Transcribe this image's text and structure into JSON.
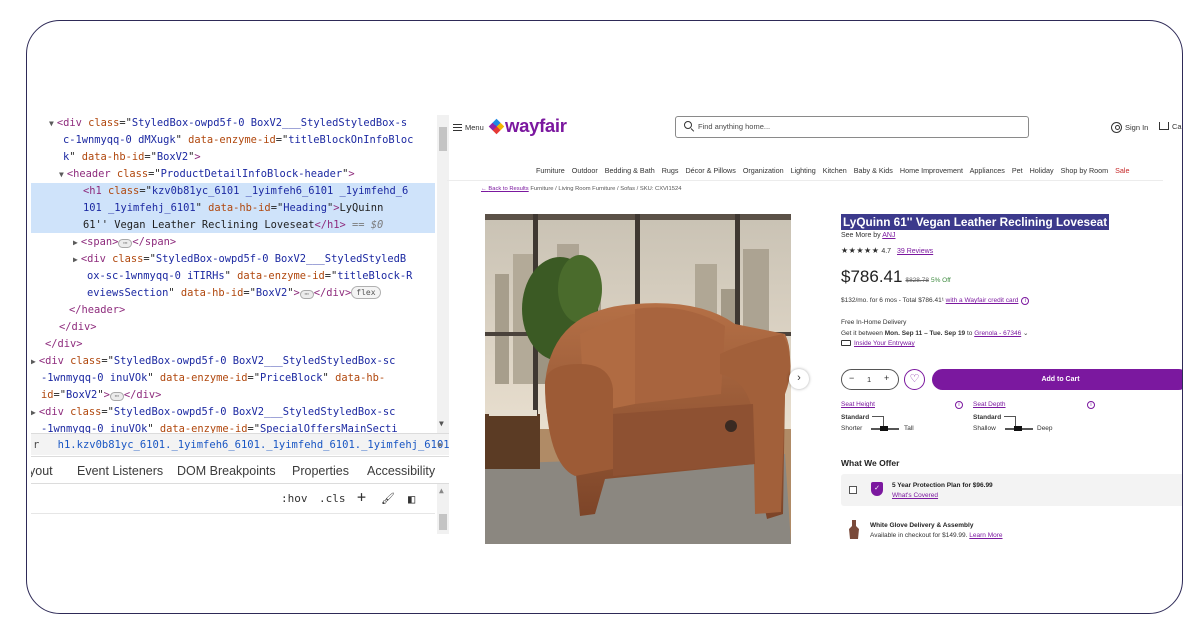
{
  "devtools": {
    "code_lines": [
      {
        "parts": [
          [
            "tri",
            "▼"
          ],
          [
            "tag",
            "<div "
          ],
          [
            "attr",
            "class"
          ],
          [
            "txt",
            "=\""
          ],
          [
            "val",
            "StyledBox-owpd5f-0 BoxV2___StyledStyledBox-s"
          ]
        ]
      },
      {
        "parts": [
          [
            "val",
            "c-1wnmyqq-0 dMXugk"
          ],
          [
            "txt",
            "\" "
          ],
          [
            "attr",
            "data-enzyme-id"
          ],
          [
            "txt",
            "=\""
          ],
          [
            "val",
            "titleBlockOnInfoBloc"
          ]
        ]
      },
      {
        "parts": [
          [
            "val",
            "k"
          ],
          [
            "txt",
            "\" "
          ],
          [
            "attr",
            "data-hb-id"
          ],
          [
            "txt",
            "=\""
          ],
          [
            "val",
            "BoxV2"
          ],
          [
            "txt",
            "\""
          ],
          [
            "tag",
            ">"
          ]
        ]
      },
      {
        "parts": [
          [
            "tri",
            "▼"
          ],
          [
            "tag",
            "<header "
          ],
          [
            "attr",
            "class"
          ],
          [
            "txt",
            "=\""
          ],
          [
            "val",
            "ProductDetailInfoBlock-header"
          ],
          [
            "txt",
            "\""
          ],
          [
            "tag",
            ">"
          ]
        ]
      },
      {
        "parts": [
          [
            "tag",
            "<h1 "
          ],
          [
            "attr",
            "class"
          ],
          [
            "txt",
            "=\""
          ],
          [
            "val",
            "kzv0b81yc_6101 _1yimfeh6_6101 _1yimfehd_6"
          ]
        ]
      },
      {
        "parts": [
          [
            "val",
            "101 _1yimfehj_6101"
          ],
          [
            "txt",
            "\" "
          ],
          [
            "attr",
            "data-hb-id"
          ],
          [
            "txt",
            "=\""
          ],
          [
            "val",
            "Heading"
          ],
          [
            "txt",
            "\""
          ],
          [
            "tag",
            ">"
          ],
          [
            "txt",
            "LyQuinn"
          ]
        ]
      },
      {
        "parts": [
          [
            "txt",
            "61'' Vegan Leather Reclining Loveseat"
          ],
          [
            "tag",
            "</h1>"
          ],
          [
            "dim",
            " == $0"
          ]
        ]
      },
      {
        "parts": [
          [
            "tri",
            "▶"
          ],
          [
            "tag",
            "<span>"
          ],
          [
            "ell",
            "⋯"
          ],
          [
            "tag",
            "</span>"
          ]
        ]
      },
      {
        "parts": [
          [
            "tri",
            "▶"
          ],
          [
            "tag",
            "<div "
          ],
          [
            "attr",
            "class"
          ],
          [
            "txt",
            "=\""
          ],
          [
            "val",
            "StyledBox-owpd5f-0 BoxV2___StyledStyledB"
          ]
        ]
      },
      {
        "parts": [
          [
            "val",
            "ox-sc-1wnmyqq-0 iTIRHs"
          ],
          [
            "txt",
            "\" "
          ],
          [
            "attr",
            "data-enzyme-id"
          ],
          [
            "txt",
            "=\""
          ],
          [
            "val",
            "titleBlock-R"
          ]
        ]
      },
      {
        "parts": [
          [
            "val",
            "eviewsSection"
          ],
          [
            "txt",
            "\" "
          ],
          [
            "attr",
            "data-hb-id"
          ],
          [
            "txt",
            "=\""
          ],
          [
            "val",
            "BoxV2"
          ],
          [
            "txt",
            "\""
          ],
          [
            "tag",
            ">"
          ],
          [
            "ell",
            "⋯"
          ],
          [
            "tag",
            "</div>"
          ],
          [
            "pill",
            "flex"
          ]
        ]
      },
      {
        "parts": [
          [
            "tag",
            "</header>"
          ]
        ]
      },
      {
        "parts": [
          [
            "tag",
            "</div>"
          ]
        ]
      },
      {
        "parts": [
          [
            "tag",
            "</div>"
          ]
        ]
      },
      {
        "parts": [
          [
            "tri",
            "▶"
          ],
          [
            "tag",
            "<div "
          ],
          [
            "attr",
            "class"
          ],
          [
            "txt",
            "=\""
          ],
          [
            "val",
            "StyledBox-owpd5f-0 BoxV2___StyledStyledBox-sc"
          ]
        ]
      },
      {
        "parts": [
          [
            "val",
            "-1wnmyqq-0 inuVOk"
          ],
          [
            "txt",
            "\" "
          ],
          [
            "attr",
            "data-enzyme-id"
          ],
          [
            "txt",
            "=\""
          ],
          [
            "val",
            "PriceBlock"
          ],
          [
            "txt",
            "\" "
          ],
          [
            "attr",
            "data-hb-"
          ]
        ]
      },
      {
        "parts": [
          [
            "attr",
            "id"
          ],
          [
            "txt",
            "=\""
          ],
          [
            "val",
            "BoxV2"
          ],
          [
            "txt",
            "\""
          ],
          [
            "tag",
            ">"
          ],
          [
            "ell",
            "⋯"
          ],
          [
            "tag",
            "</div>"
          ]
        ]
      },
      {
        "parts": [
          [
            "tri",
            "▶"
          ],
          [
            "tag",
            "<div "
          ],
          [
            "attr",
            "class"
          ],
          [
            "txt",
            "=\""
          ],
          [
            "val",
            "StyledBox-owpd5f-0 BoxV2___StyledStyledBox-sc"
          ]
        ]
      },
      {
        "parts": [
          [
            "val",
            "-1wnmyqq-0 inuVOk"
          ],
          [
            "txt",
            "\" "
          ],
          [
            "attr",
            "data-enzyme-id"
          ],
          [
            "txt",
            "=\""
          ],
          [
            "val",
            "SpecialOffersMainSecti"
          ]
        ]
      }
    ],
    "breadcrumb": {
      "prev": "r",
      "current": "h1.kzv0b81yc_6101._1yimfeh6_6101._1yimfehd_6101._1yimfehj_6101"
    },
    "tabs": [
      "yout",
      "Event Listeners",
      "DOM Breakpoints",
      "Properties",
      "Accessibility"
    ],
    "filter": {
      "hov": ":hov",
      "cls": ".cls",
      "plus": "+",
      "paint": "🖌",
      "toggle": "◧"
    }
  },
  "wayfair": {
    "menu_label": "Menu",
    "logo_text": "wayfair",
    "search_placeholder": "Find anything home...",
    "sign_in": "Sign In",
    "cart": "Cart",
    "nav": [
      "Furniture",
      "Outdoor",
      "Bedding & Bath",
      "Rugs",
      "Décor & Pillows",
      "Organization",
      "Lighting",
      "Kitchen",
      "Baby & Kids",
      "Home Improvement",
      "Appliances",
      "Pet",
      "Holiday",
      "Shop by Room"
    ],
    "nav_sale": "Sale",
    "breadcrumb": {
      "back": "Back to Results",
      "trail": "Furniture / Living Room Furniture / Sofas / SKU: CXVI1524"
    },
    "product": {
      "title": "LyQuinn 61'' Vegan Leather Reclining Loveseat",
      "see_more_prefix": "See More by",
      "brand": "ANJ",
      "rating": "4.7",
      "stars": "★★★★★",
      "reviews": "39 Reviews",
      "price": "$786.41",
      "was_price": "$828.78",
      "discount": "5% Off",
      "finance": "$132/mo. for 6 mos - Total $786.41¹",
      "finance_link": "with a Wayfair credit card",
      "delivery_title": "Free In-Home Delivery",
      "delivery_line_prefix": "Get it between",
      "delivery_dates": "Mon. Sep 11 – Tue. Sep 19",
      "delivery_to": "to",
      "delivery_location": "Grenola - 67346",
      "entryway": "Inside Your Entryway",
      "qty_minus": "−",
      "qty_value": "1",
      "qty_plus": "+",
      "add_to_cart": "Add to Cart",
      "seat_height": {
        "label": "Seat Height",
        "value": "Standard",
        "min": "Shorter",
        "max": "Tall"
      },
      "seat_depth": {
        "label": "Seat Depth",
        "value": "Standard",
        "min": "Shallow",
        "max": "Deep"
      },
      "offers_heading": "What We Offer",
      "protection": {
        "title": "5 Year Protection Plan for $96.99",
        "link": "What's Covered"
      },
      "white_glove": {
        "title": "White Glove Delivery & Assembly",
        "text": "Available in checkout for $149.99.",
        "link": "Learn More"
      }
    }
  },
  "colors": {
    "brand": "#7b189f",
    "selection": "#3c3a8c",
    "frame": "#2e2a57",
    "devtools_highlight": "#cfe3fa"
  }
}
